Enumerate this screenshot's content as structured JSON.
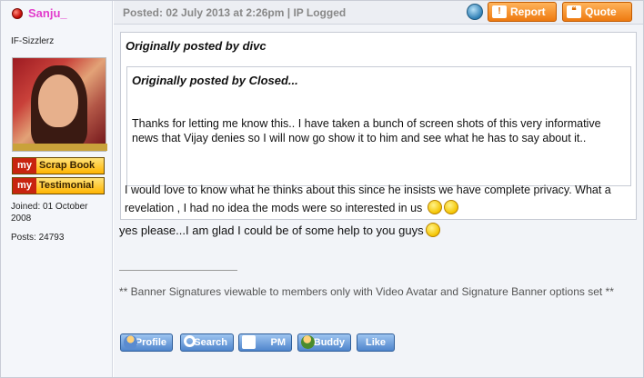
{
  "user": {
    "name": "Sanju_",
    "rank": "IF-Sizzlerz",
    "scrapbook_my": "my",
    "scrapbook_label": "Scrap Book",
    "testimonial_my": "my",
    "testimonial_label": "Testimonial",
    "joined": "Joined: 01 October 2008",
    "posts": "Posts: 24793"
  },
  "post": {
    "posted": "Posted: 02 July 2013 at 2:26pm | IP Logged",
    "report_label": "Report",
    "quote_label": "Quote",
    "outer_quote_title": "Originally posted by divc",
    "inner_quote_title": "Originally posted by Closed...",
    "inner_quote_text": "Thanks for letting me know this.. I have taken a bunch of screen shots of this very informative news that Vijay denies so I will now go show it to him and see what he has to say about it..",
    "outer_quote_text": "I would love to know what he thinks about this since he insists we have complete privacy. What a revelation , I had no idea the mods were so interested in us",
    "reply_text": "yes please...I am glad I could be of some help to you guys",
    "signature_text": "** Banner Signatures viewable to members only with Video Avatar and Signature Banner options set **"
  },
  "actions": {
    "profile": "Profile",
    "search": "Search",
    "pm": "PM",
    "buddy": "Buddy",
    "like": "Like"
  },
  "icons": [
    "online-status-icon",
    "profile-globe-icon",
    "report-icon",
    "quote-icon",
    "smiley-icon",
    "profile-icon",
    "search-icon",
    "pm-icon",
    "buddy-icon"
  ],
  "colors": {
    "username": "#e23ccc",
    "action_button": "#4f85cc",
    "header_button": "#ee7a10"
  }
}
